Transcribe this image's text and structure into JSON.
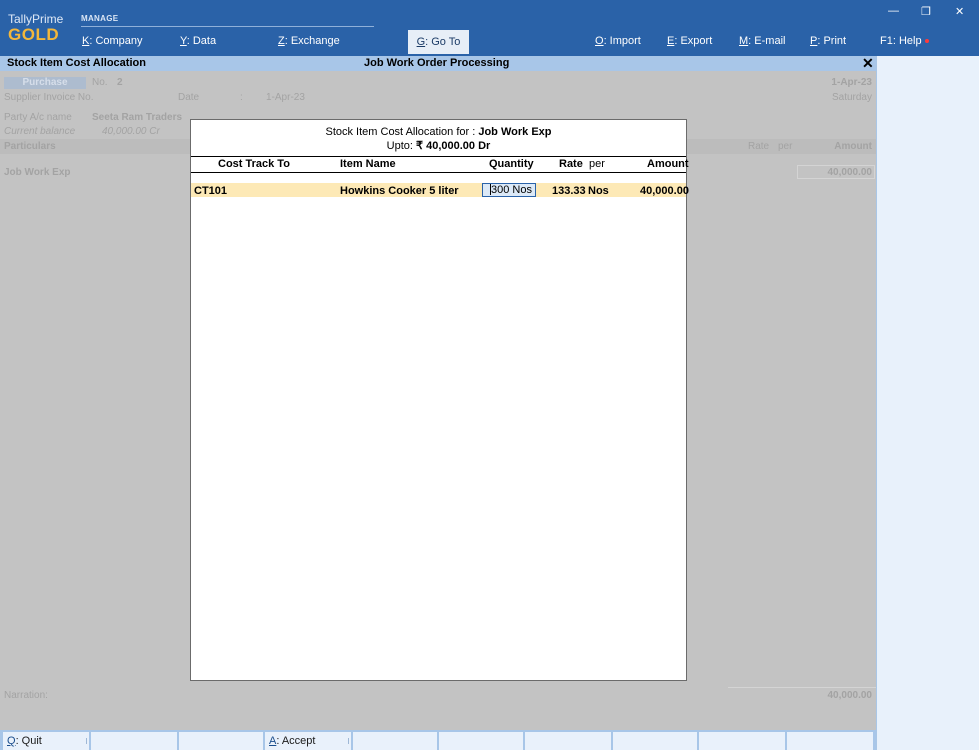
{
  "app": {
    "brand_top": "TallyPrime",
    "brand_bottom": "GOLD",
    "manage_label": "MANAGE"
  },
  "menu": {
    "company": {
      "key": "K",
      "label": ": Company"
    },
    "data": {
      "key": "Y",
      "label": ": Data"
    },
    "exchange": {
      "key": "Z",
      "label": ": Exchange"
    },
    "goto": {
      "key": "G",
      "label": ": Go To"
    },
    "import": {
      "key": "O",
      "label": ": Import"
    },
    "export": {
      "key": "E",
      "label": ": Export"
    },
    "email": {
      "key": "M",
      "label": ": E-mail"
    },
    "print": {
      "key": "P",
      "label": ": Print"
    },
    "help": {
      "key": "F1",
      "label": ": Help"
    }
  },
  "window_controls": {
    "minimize": "—",
    "restore": "❐",
    "close": "✕"
  },
  "title_strip": {
    "left": "Stock Item Cost Allocation",
    "center": "Job Work Order Processing",
    "close": "✕"
  },
  "voucher": {
    "type": "Purchase",
    "no_label": "No.",
    "no_value": "2",
    "date": "1-Apr-23",
    "day": "Saturday",
    "supplier_invoice_label": "Supplier Invoice No.",
    "date_label": "Date",
    "date_colon": ":",
    "date_value": "1-Apr-23",
    "party_label": "Party A/c name",
    "party_value": "Seeta Ram Traders",
    "current_balance_label": "Current balance",
    "current_balance_value": "40,000.00 Cr",
    "particulars_label": "Particulars",
    "rate_label": "Rate",
    "per_label": "per",
    "amount_label": "Amount",
    "ledger": "Job Work Exp",
    "ledger_amount": "40,000.00",
    "narration_label": "Narration:",
    "total": "40,000.00"
  },
  "modal": {
    "alloc_label": "Stock Item Cost Allocation for :",
    "alloc_item": "Job Work Exp",
    "upto_label": "Upto:",
    "upto_value": "₹ 40,000.00 Dr",
    "columns": {
      "cost_track": "Cost Track To",
      "item_name": "Item Name",
      "quantity": "Quantity",
      "rate": "Rate",
      "per": "per",
      "amount": "Amount"
    },
    "row": {
      "cost_track": "CT101",
      "item_name": "Howkins Cooker 5 liter",
      "qty_cursor_digit": "3",
      "qty_rest": "00 Nos",
      "rate": "133.33",
      "per": "Nos",
      "amount": "40,000.00"
    }
  },
  "bottom": {
    "quit": {
      "key": "Q",
      "label": ": Quit"
    },
    "accept": {
      "key": "A",
      "label": ": Accept"
    }
  }
}
